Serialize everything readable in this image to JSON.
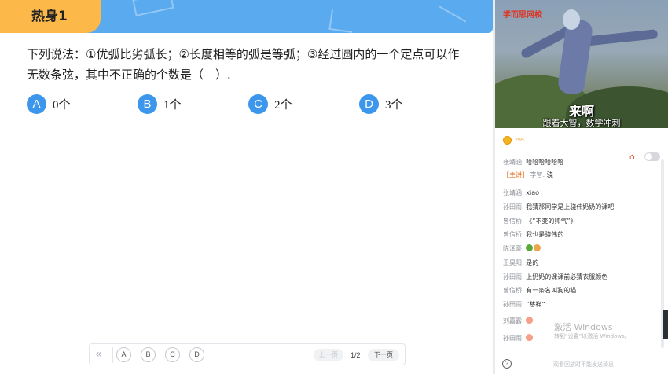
{
  "lesson": {
    "title": "热身1",
    "question_line1": "下列说法：①优弧比劣弧长；②长度相等的弧是等弧；③经过圆内的一个定点可以作",
    "question_line2": "无数条弦，其中不正确的个数是（　）.",
    "options": [
      {
        "letter": "A",
        "text": "0个"
      },
      {
        "letter": "B",
        "text": "1个"
      },
      {
        "letter": "C",
        "text": "2个"
      },
      {
        "letter": "D",
        "text": "3个"
      }
    ],
    "accent_color": "#5aaaf0",
    "title_tab_color": "#fcb94a"
  },
  "pager": {
    "back_icon": "double-chevron-left-icon",
    "back_glyph": "«",
    "answer_chips": [
      "A",
      "B",
      "C",
      "D"
    ],
    "prev_label": "上一页",
    "page_indicator": "1/2",
    "next_label": "下一页"
  },
  "video": {
    "watermark": "学而思网校",
    "subtitle_big": "来啊",
    "subtitle_small": "跟着大智，数学冲刺"
  },
  "chat": {
    "coins": "259",
    "messages": [
      {
        "name": "张靖涵:",
        "text": "哈哈哈哈哈哈"
      },
      {
        "role": "【主讲】",
        "name": "李智:",
        "text": "骁"
      },
      {
        "name": "张靖涵:",
        "text": "xiao"
      },
      {
        "name": "孙田雨:",
        "text": "我猜那同学是上骁伟奶奶的课吧"
      },
      {
        "name": "曾信桥:",
        "text": "《“不变的帅气”》"
      },
      {
        "name": "曾信桥:",
        "text": "我也是骁伟的"
      },
      {
        "name": "陈泽豪:",
        "text": ""
      },
      {
        "name": "王昊阳:",
        "text": "是的"
      },
      {
        "name": "孙田雨:",
        "text": "上奶奶的课课前必猜衣服颜色"
      },
      {
        "name": "曾信桥:",
        "text": "有一条名叫狗的猫"
      },
      {
        "name": "孙田雨:",
        "text": "“慈祥”"
      },
      {
        "name": "刘嘉露:",
        "text": ""
      },
      {
        "name": "孙田雨:",
        "text": ""
      }
    ],
    "windows_activate_title": "激活 Windows",
    "windows_activate_sub": "转到“设置”以激活 Windows。",
    "footer_text": "观看回放时不能发送消息"
  }
}
